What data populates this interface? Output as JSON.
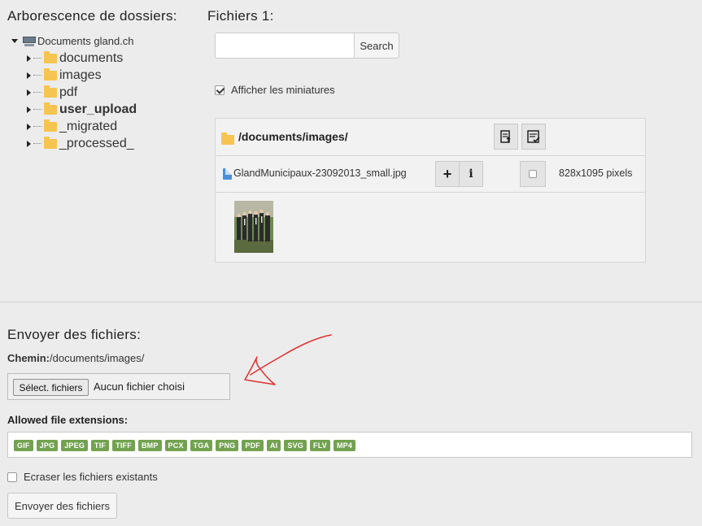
{
  "tree": {
    "heading": "Arborescence de dossiers:",
    "root": "Documents gland.ch",
    "items": [
      {
        "label": "documents",
        "bold": false
      },
      {
        "label": "images",
        "bold": false
      },
      {
        "label": "pdf",
        "bold": false
      },
      {
        "label": "user_upload",
        "bold": true
      },
      {
        "label": "_migrated",
        "bold": false
      },
      {
        "label": "_processed_",
        "bold": false
      }
    ]
  },
  "files": {
    "heading": "Fichiers 1:",
    "search": {
      "value": "",
      "placeholder": "",
      "button": "Search"
    },
    "thumbnails_label": "Afficher les miniatures",
    "thumbnails_checked": true,
    "path": "/documents/images/",
    "file": {
      "name": "GlandMunicipaux-23092013_small.jpg",
      "dimensions": "828x1095 pixels",
      "add_icon": "+",
      "info_icon": "i"
    }
  },
  "upload": {
    "heading": "Envoyer des fichiers:",
    "path_label": "Chemin:",
    "path_value": "/documents/images/",
    "choose_button": "Sélect. fichiers",
    "no_file": "Aucun fichier choisi",
    "ext_label": "Allowed file extensions:",
    "extensions": [
      "GIF",
      "JPG",
      "JPEG",
      "TIF",
      "TIFF",
      "BMP",
      "PCX",
      "TGA",
      "PNG",
      "PDF",
      "AI",
      "SVG",
      "FLV",
      "MP4"
    ],
    "overwrite_label": "Ecraser les fichiers existants",
    "overwrite_checked": false,
    "send_button": "Envoyer des fichiers"
  },
  "colors": {
    "extension_badge": "#72a24f",
    "folder": "#f6c451",
    "annotation": "#e03030"
  }
}
